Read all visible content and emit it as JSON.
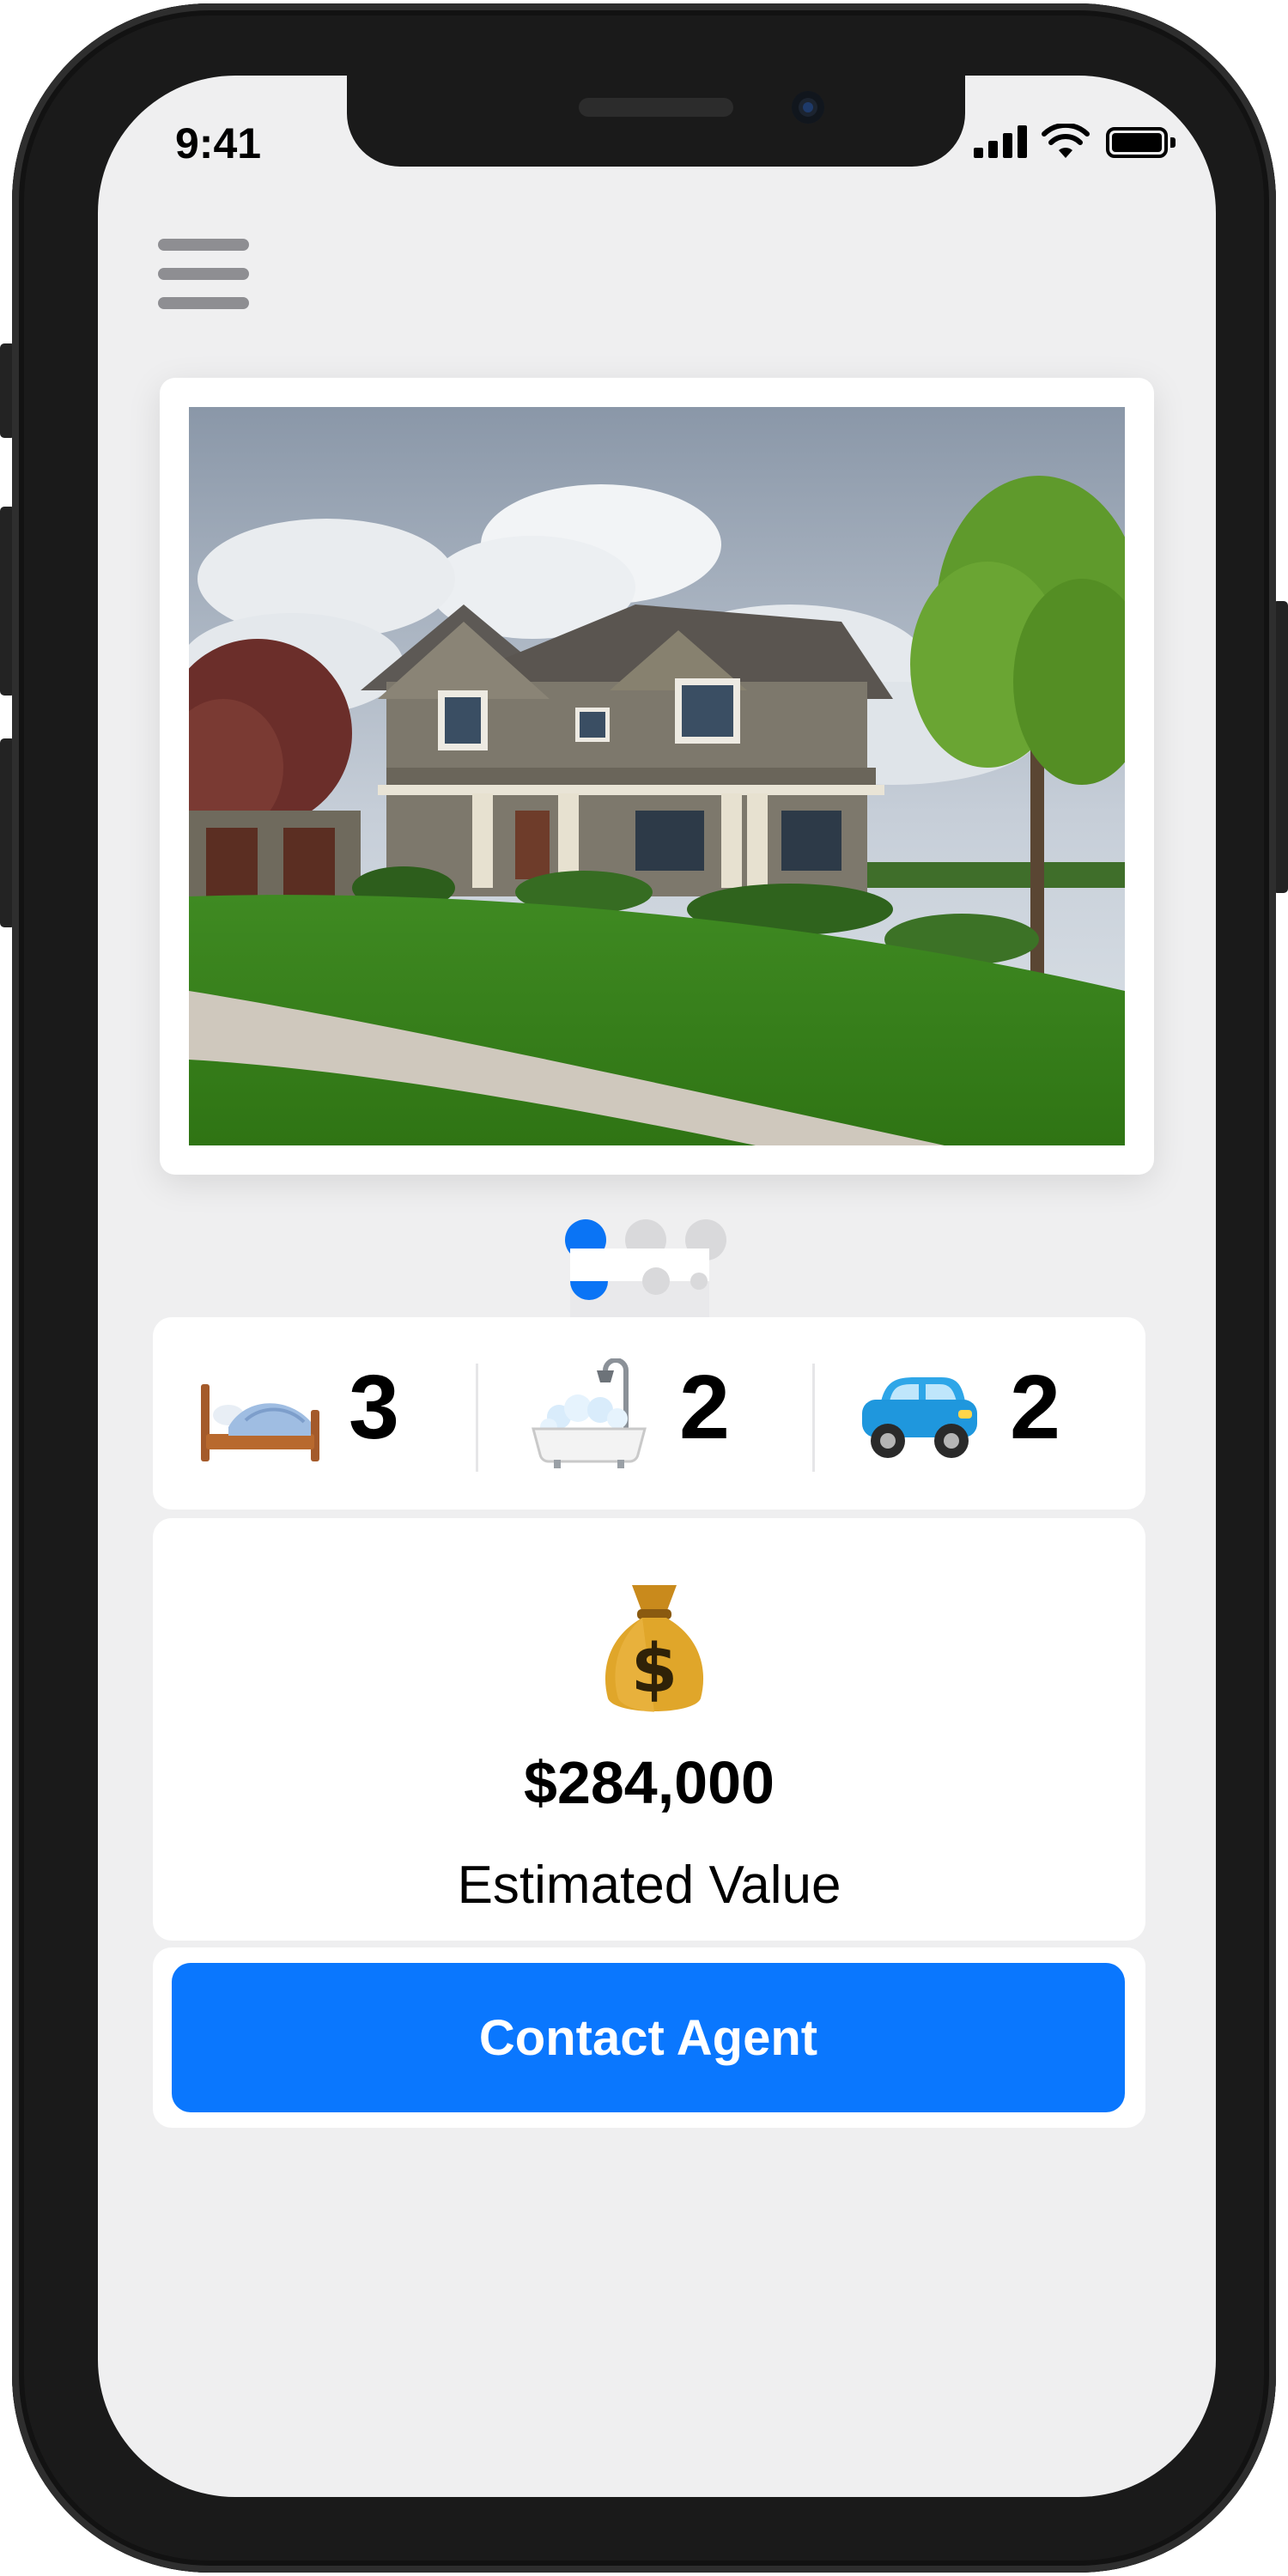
{
  "status_bar": {
    "time": "9:41"
  },
  "menu": {
    "icon": "hamburger-menu-icon"
  },
  "listing": {
    "photo": {
      "description": "two-story suburban house with green lawn and tree",
      "pages": 3,
      "active_page": 1
    },
    "features": [
      {
        "name": "bedrooms",
        "icon": "bed-emoji",
        "value": "3"
      },
      {
        "name": "bathrooms",
        "icon": "bathtub-emoji",
        "value": "2"
      },
      {
        "name": "garage",
        "icon": "car-emoji",
        "value": "2"
      }
    ],
    "estimated_value": {
      "icon": "money-bag-emoji",
      "amount": "$284,000",
      "label": "Estimated Value"
    },
    "contact": {
      "label": "Contact Agent"
    }
  },
  "colors": {
    "accent": "#0A77FE",
    "background": "#EFEFF0",
    "card": "#FFFFFF",
    "inactive_dot": "#D9D9DB"
  }
}
